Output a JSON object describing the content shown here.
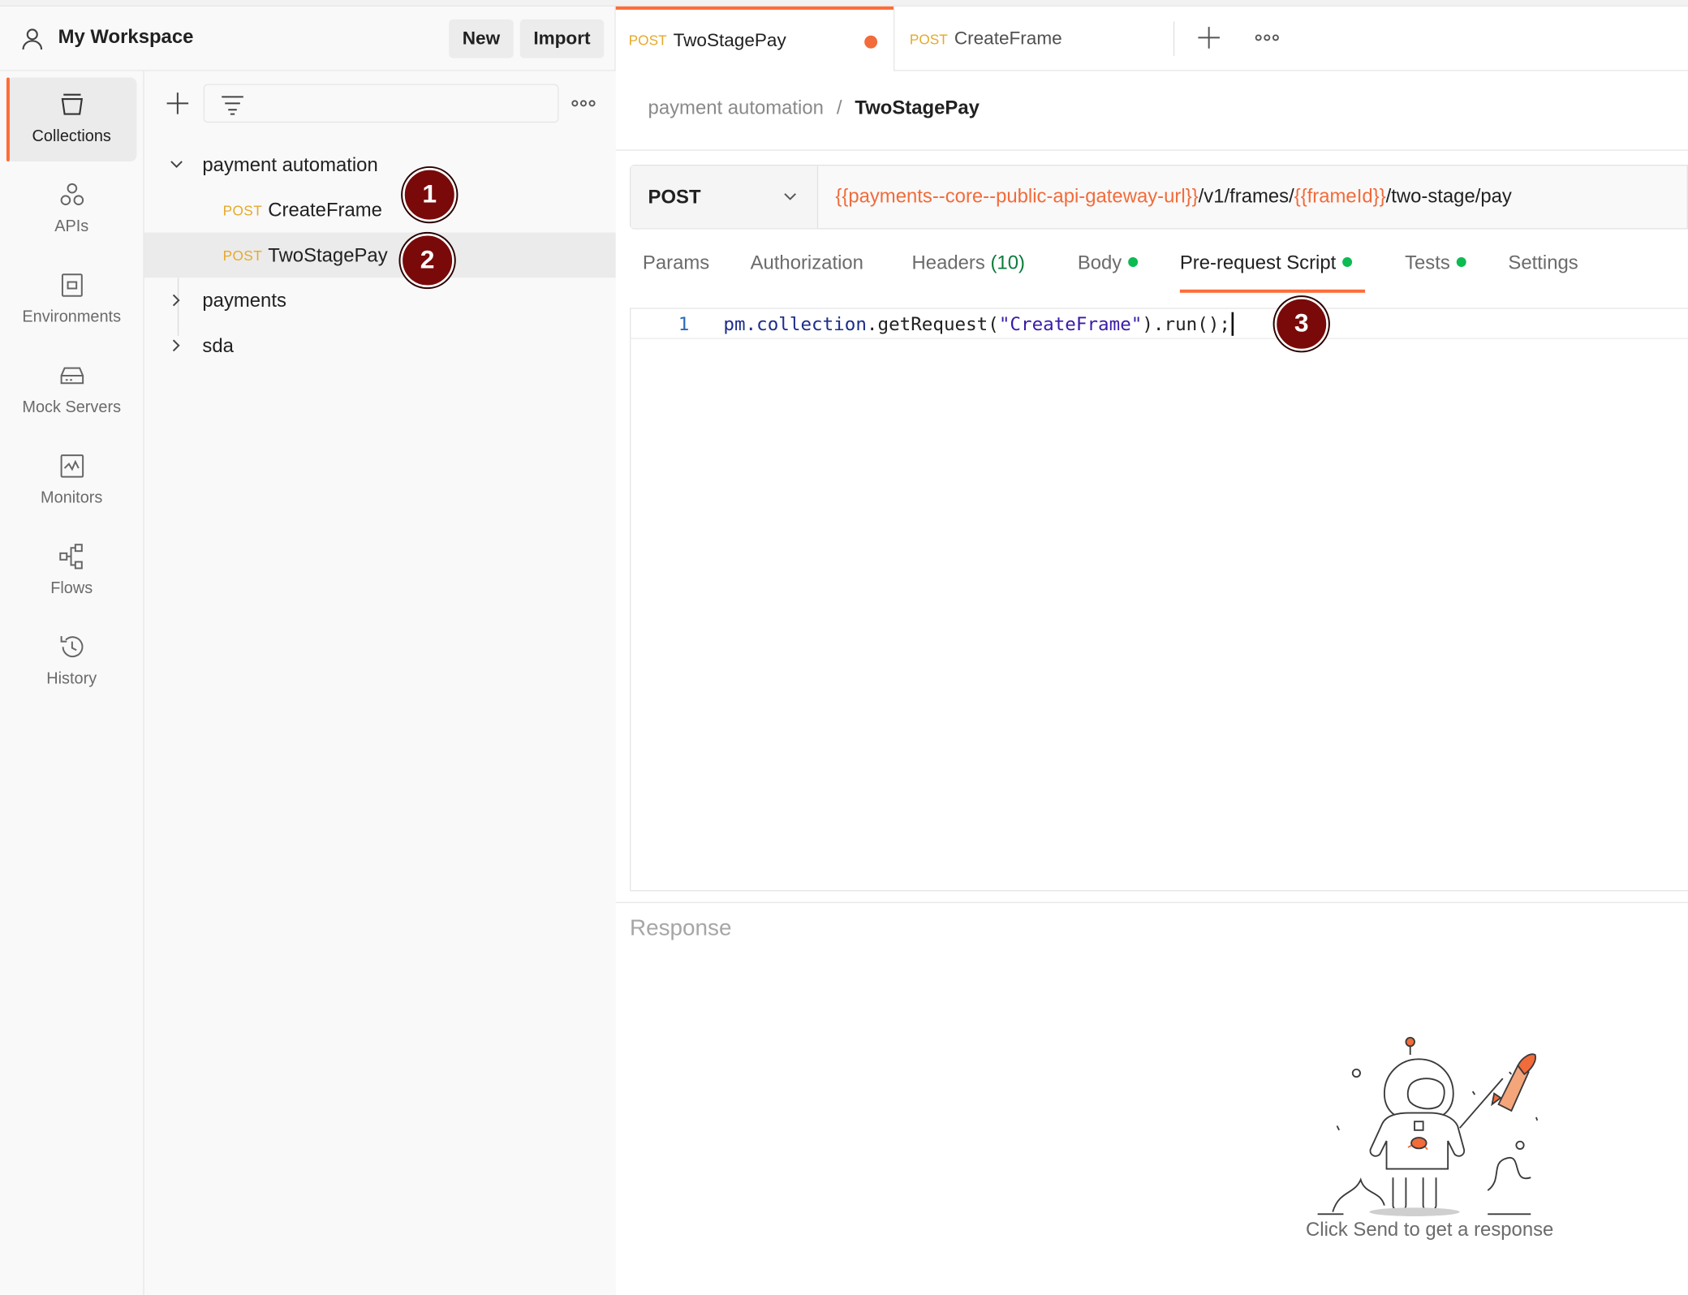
{
  "workspace": {
    "title": "My Workspace",
    "new_label": "New",
    "import_label": "Import"
  },
  "rail": [
    {
      "label": "Collections",
      "icon": "collections-icon"
    },
    {
      "label": "APIs",
      "icon": "apis-icon"
    },
    {
      "label": "Environments",
      "icon": "environments-icon"
    },
    {
      "label": "Mock Servers",
      "icon": "mock-servers-icon"
    },
    {
      "label": "Monitors",
      "icon": "monitors-icon"
    },
    {
      "label": "Flows",
      "icon": "flows-icon"
    },
    {
      "label": "History",
      "icon": "history-icon"
    }
  ],
  "tree": {
    "collections": [
      {
        "name": "payment automation",
        "expanded": true,
        "requests": [
          {
            "method": "POST",
            "name": "CreateFrame"
          },
          {
            "method": "POST",
            "name": "TwoStagePay"
          }
        ]
      },
      {
        "name": "payments",
        "expanded": false
      },
      {
        "name": "sda",
        "expanded": false
      }
    ]
  },
  "tabs": [
    {
      "method": "POST",
      "name": "TwoStagePay"
    },
    {
      "method": "POST",
      "name": "CreateFrame"
    }
  ],
  "breadcrumb": {
    "parent": "payment automation",
    "separator": "/",
    "current": "TwoStagePay"
  },
  "request": {
    "method": "POST",
    "url_var1": "{{payments--core--public-api-gateway-url}}",
    "url_mid": "/v1/frames/",
    "url_var2": "{{frameId}}",
    "url_end": "/two-stage/pay"
  },
  "request_tabs": {
    "params": "Params",
    "authorization": "Authorization",
    "headers": "Headers",
    "headers_count": "(10)",
    "body": "Body",
    "prerequest": "Pre-request Script",
    "tests": "Tests",
    "settings": "Settings"
  },
  "editor": {
    "line_number": "1",
    "code_ident": "pm.collection",
    "code_method": ".getRequest(",
    "code_string": "\"CreateFrame\"",
    "code_tail": ").run();"
  },
  "response": {
    "title": "Response",
    "hint": "Click Send to get a response"
  },
  "badges": [
    "1",
    "2",
    "3"
  ],
  "colors": {
    "accent": "#ff6c37",
    "method_post": "#e6a92a",
    "variable": "#f26b3a",
    "badge": "#7a0a0a",
    "active_dot": "#0cbb52"
  }
}
